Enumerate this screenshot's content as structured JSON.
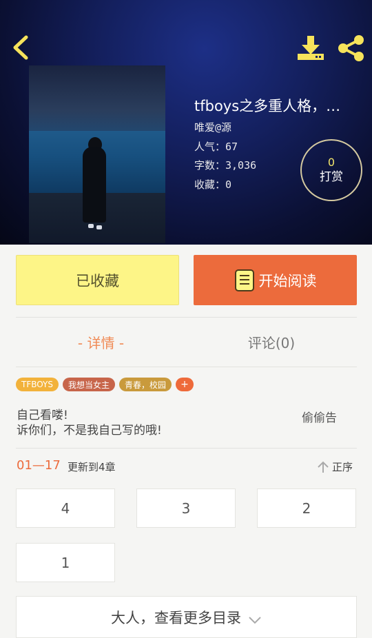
{
  "book": {
    "title": "tfboys之多重人格，…",
    "author": "唯爱@源",
    "popularity": "人气：67",
    "word_count": "字数：3,036",
    "favorites": "收藏：0"
  },
  "tip": {
    "count": "0",
    "label": "打赏"
  },
  "actions": {
    "collected_label": "已收藏",
    "read_label": "开始阅读"
  },
  "tabs": {
    "detail": "- 详情 -",
    "comments": "评论(0)"
  },
  "tags": [
    "TFBOYS",
    "我想当女主",
    "青春，校园",
    "+"
  ],
  "description": {
    "line1": "自己看喽!",
    "line2": "诉你们，不是我自己写的哦!",
    "secret": "偷偷告"
  },
  "update": {
    "date": "01—17",
    "text": "更新到4章",
    "sort_label": "正序"
  },
  "chapters": [
    "4",
    "3",
    "2",
    "1"
  ],
  "more_label": "大人，查看更多目录",
  "colors": {
    "accent": "#ec6b3c",
    "collected": "#fdf587",
    "icon_yellow": "#f6e35b"
  },
  "icons": [
    "back-icon",
    "download-icon",
    "share-icon",
    "book-icon",
    "up-arrow-icon",
    "chevron-down-icon"
  ]
}
